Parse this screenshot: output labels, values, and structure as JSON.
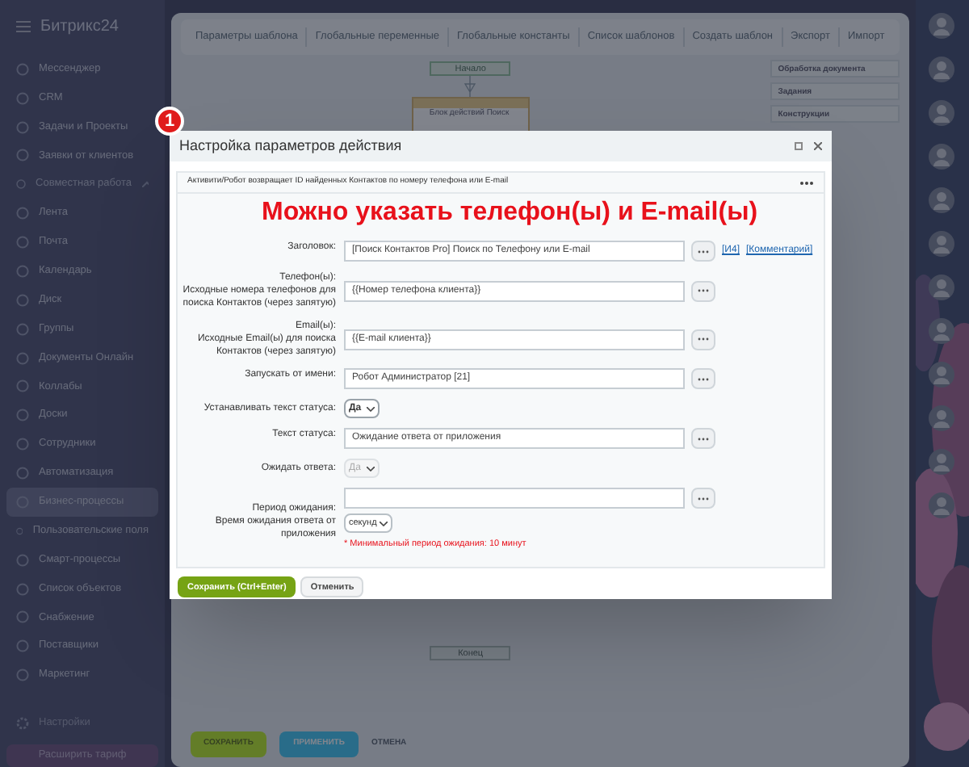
{
  "sidebar": {
    "logo": "Битрикс24",
    "items": [
      {
        "label": "Мессенджер",
        "selected": false
      },
      {
        "label": "CRM",
        "selected": false
      },
      {
        "label": "Задачи и Проекты",
        "selected": false
      },
      {
        "label": "Заявки от клиентов",
        "selected": false
      },
      {
        "label": "Совместная работа",
        "selected": false,
        "kind": "group",
        "expanded": true
      },
      {
        "label": "Лента",
        "selected": false
      },
      {
        "label": "Почта",
        "selected": false
      },
      {
        "label": "Календарь",
        "selected": false
      },
      {
        "label": "Диск",
        "selected": false
      },
      {
        "label": "Группы",
        "selected": false
      },
      {
        "label": "Документы Онлайн",
        "selected": false
      },
      {
        "label": "Коллабы",
        "selected": false
      },
      {
        "label": "Доски",
        "selected": false
      },
      {
        "label": "Сотрудники",
        "selected": false
      },
      {
        "label": "Автоматизация",
        "selected": false
      },
      {
        "label": "Бизнес-процессы",
        "selected": true
      },
      {
        "label": "Пользовательские поля",
        "selected": false
      },
      {
        "label": "Смарт-процессы",
        "selected": false
      },
      {
        "label": "Список объектов",
        "selected": false
      },
      {
        "label": "Снабжение",
        "selected": false
      },
      {
        "label": "Поставщики",
        "selected": false
      },
      {
        "label": "Маркетинг",
        "selected": false
      }
    ],
    "settings": "Настройки",
    "upgrade_button": "Расширить тариф"
  },
  "toolbar": [
    "Параметры шаблона",
    "Глобальные переменные",
    "Глобальные константы",
    "Список шаблонов",
    "Создать шаблон",
    "Экспорт",
    "Импорт"
  ],
  "canvas": {
    "start": "Начало",
    "block": "Блок действий Поиск",
    "end": "Конец"
  },
  "right_panel": [
    "Обработка документа",
    "Задания",
    "Конструкции"
  ],
  "bottom_buttons": [
    "СОХРАНИТЬ",
    "ПРИМЕНИТЬ",
    "ОТМЕНА"
  ],
  "dialog": {
    "badge": "1",
    "title": "Настройка параметров действия",
    "description": "Активити/Робот возвращает ID найденных Контактов по номеру телефона или E-mail",
    "annotation": "Можно указать телефон(ы) и E-mail(ы)",
    "fields": [
      {
        "kind": "textarea",
        "label": "Заголовок:",
        "value": "[Поиск Контактов Pro] Поиск по Телефону или E-mail",
        "links": [
          "[И4]",
          "[Комментарий]"
        ]
      },
      {
        "kind": "textarea",
        "label": "Телефон(ы):",
        "hint": "Исходные номера телефонов для поиска Контактов (через запятую)",
        "value": "{{Номер телефона клиента}}"
      },
      {
        "kind": "textarea",
        "label": "Email(ы):",
        "hint": "Исходные Email(ы) для поиска Контактов (через запятую)",
        "value": "{{E-mail клиента}}"
      },
      {
        "kind": "textarea",
        "label": "Запускать от имени:",
        "value": "Робот Администратор [21]"
      },
      {
        "kind": "select",
        "label": "Устанавливать текст статуса:",
        "value": "Да",
        "disabled": false
      },
      {
        "kind": "textarea",
        "label": "Текст статуса:",
        "value": "Ожидание ответа от приложения"
      },
      {
        "kind": "select",
        "label": "Ожидать ответа:",
        "value": "Да",
        "disabled": true
      },
      {
        "kind": "period",
        "label": "Период ожидания:",
        "hint": "Время ожидания ответа от приложения",
        "unit": "секунд",
        "note": "* Минимальный период ожидания: 10 минут"
      }
    ],
    "buttons": [
      {
        "label": "Сохранить (Ctrl+Enter)",
        "kind": "primary"
      },
      {
        "label": "Отменить",
        "kind": "secondary"
      }
    ]
  }
}
